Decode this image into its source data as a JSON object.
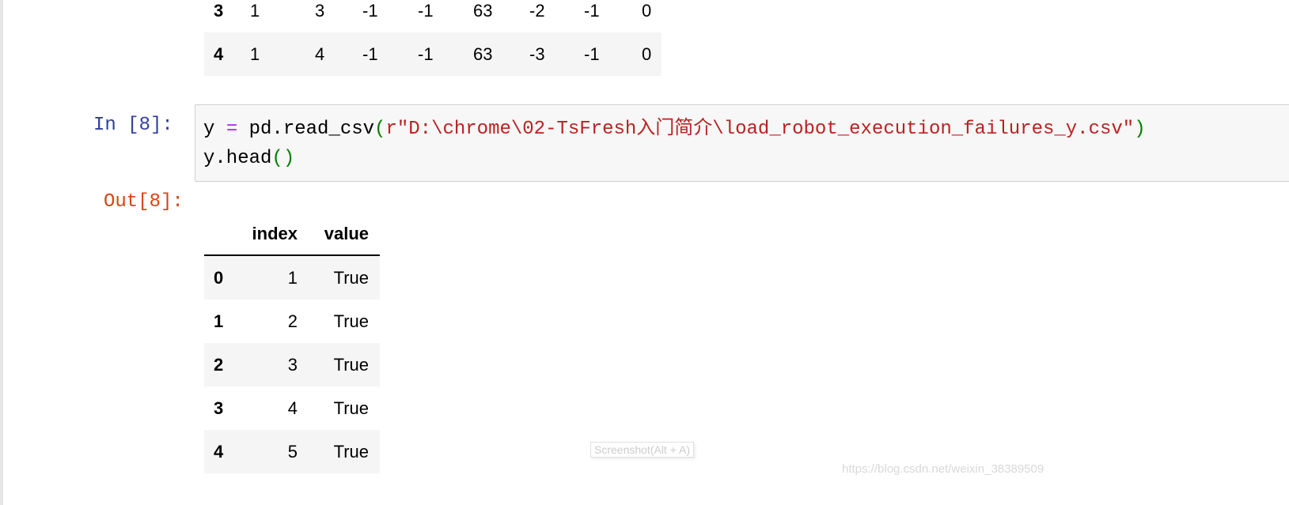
{
  "prev_output": {
    "rows": [
      {
        "index": "3",
        "values": [
          "1",
          "3",
          "-1",
          "-1",
          "63",
          "-2",
          "-1",
          "0"
        ]
      },
      {
        "index": "4",
        "values": [
          "1",
          "4",
          "-1",
          "-1",
          "63",
          "-3",
          "-1",
          "0"
        ]
      }
    ]
  },
  "cell8": {
    "in_prompt": "In  [8]:",
    "out_prompt": "Out[8]:",
    "code": {
      "l1_var": "y ",
      "l1_op": "=",
      "l1_call": " pd.read_csv",
      "l1_open": "(",
      "l1_str": "r\"D:\\chrome\\02-TsFresh入门简介\\load_robot_execution_failures_y.csv\"",
      "l1_close": ")",
      "l2_call": "y.head",
      "l2_parens": "()"
    },
    "table": {
      "columns": [
        "index",
        "value"
      ],
      "rows": [
        {
          "label": "0",
          "index": "1",
          "value": "True"
        },
        {
          "label": "1",
          "index": "2",
          "value": "True"
        },
        {
          "label": "2",
          "index": "3",
          "value": "True"
        },
        {
          "label": "3",
          "index": "4",
          "value": "True"
        },
        {
          "label": "4",
          "index": "5",
          "value": "True"
        }
      ]
    }
  },
  "tooltip": "Screenshot(Alt + A)",
  "watermark": "https://blog.csdn.net/weixin_38389509"
}
